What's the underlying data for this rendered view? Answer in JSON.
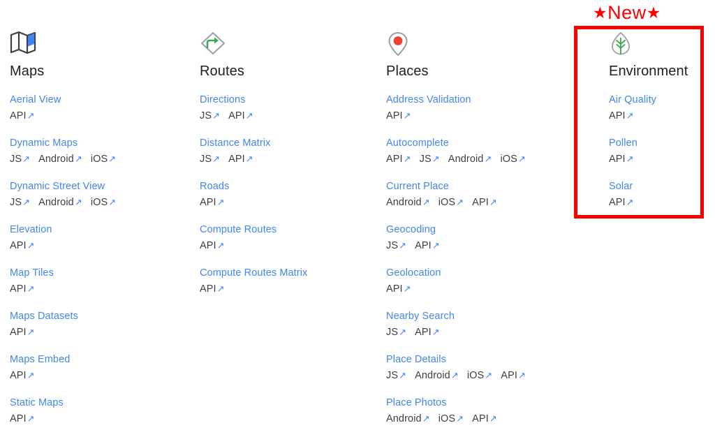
{
  "badge": {
    "left_star": "★",
    "text": "New",
    "right_star": "★",
    "color": "#ff0000"
  },
  "highlight": {
    "color": "#fa0000",
    "target": "Environment"
  },
  "theme": {
    "link_blue": "#4285f4",
    "text_dark": "#202124",
    "platform_text": "#3c4043"
  },
  "external_link_glyph": "↗",
  "columns": [
    {
      "id": "maps",
      "title": "Maps",
      "icon": "folded-map-icon",
      "products": [
        {
          "name": "Aerial View",
          "platforms": [
            "API"
          ]
        },
        {
          "name": "Dynamic Maps",
          "platforms": [
            "JS",
            "Android",
            "iOS"
          ]
        },
        {
          "name": "Dynamic Street View",
          "platforms": [
            "JS",
            "Android",
            "iOS"
          ]
        },
        {
          "name": "Elevation",
          "platforms": [
            "API"
          ]
        },
        {
          "name": "Map Tiles",
          "platforms": [
            "API"
          ]
        },
        {
          "name": "Maps Datasets",
          "platforms": [
            "API"
          ]
        },
        {
          "name": "Maps Embed",
          "platforms": [
            "API"
          ]
        },
        {
          "name": "Static Maps",
          "platforms": [
            "API"
          ]
        }
      ]
    },
    {
      "id": "routes",
      "title": "Routes",
      "icon": "turn-right-diamond-icon",
      "products": [
        {
          "name": "Directions",
          "platforms": [
            "JS",
            "API"
          ]
        },
        {
          "name": "Distance Matrix",
          "platforms": [
            "JS",
            "API"
          ]
        },
        {
          "name": "Roads",
          "platforms": [
            "API"
          ]
        },
        {
          "name": "Compute Routes",
          "platforms": [
            "API"
          ]
        },
        {
          "name": "Compute Routes Matrix",
          "platforms": [
            "API"
          ]
        }
      ]
    },
    {
      "id": "places",
      "title": "Places",
      "icon": "map-pin-icon",
      "products": [
        {
          "name": "Address Validation",
          "platforms": [
            "API"
          ]
        },
        {
          "name": "Autocomplete",
          "platforms": [
            "API",
            "JS",
            "Android",
            "iOS"
          ]
        },
        {
          "name": "Current Place",
          "platforms": [
            "Android",
            "iOS",
            "API"
          ]
        },
        {
          "name": "Geocoding",
          "platforms": [
            "JS",
            "API"
          ]
        },
        {
          "name": "Geolocation",
          "platforms": [
            "API"
          ]
        },
        {
          "name": "Nearby Search",
          "platforms": [
            "JS",
            "API"
          ]
        },
        {
          "name": "Place Details",
          "platforms": [
            "JS",
            "Android",
            "iOS",
            "API"
          ]
        },
        {
          "name": "Place Photos",
          "platforms": [
            "Android",
            "iOS",
            "API"
          ]
        }
      ]
    },
    {
      "id": "environment",
      "title": "Environment",
      "icon": "leaf-icon",
      "products": [
        {
          "name": "Air Quality",
          "platforms": [
            "API"
          ]
        },
        {
          "name": "Pollen",
          "platforms": [
            "API"
          ]
        },
        {
          "name": "Solar",
          "platforms": [
            "API"
          ]
        }
      ]
    }
  ]
}
